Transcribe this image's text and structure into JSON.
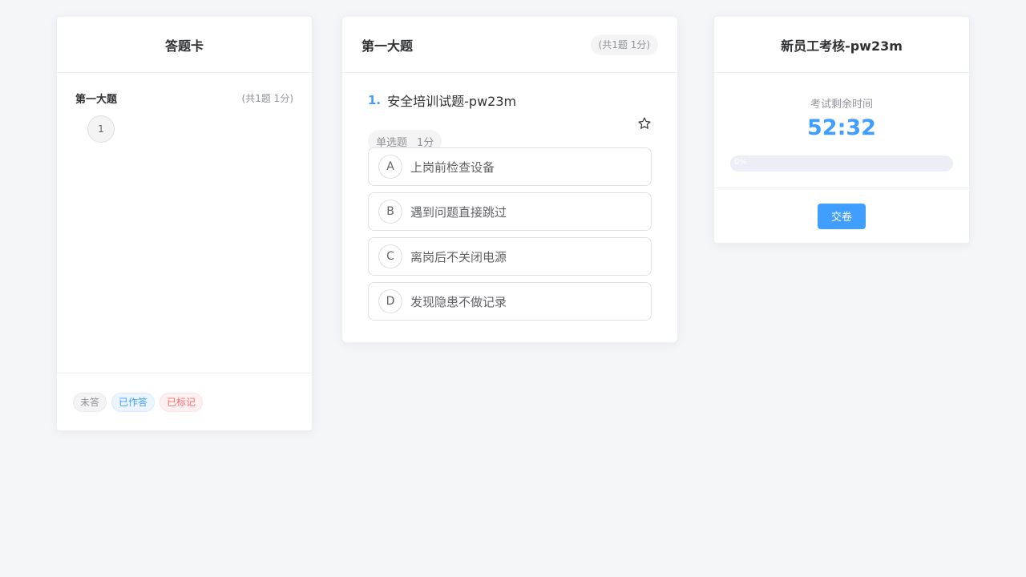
{
  "answer_sheet": {
    "title": "答题卡",
    "section_title": "第一大题",
    "section_count": "(共1题 1分)",
    "question_numbers": [
      "1"
    ],
    "legend": [
      "未答",
      "已作答",
      "已标记"
    ]
  },
  "question_panel": {
    "section_title": "第一大题",
    "section_count": "(共1题 1分)",
    "question": {
      "index": "1.",
      "text": "安全培训试题-pw23m",
      "type": "单选题",
      "score": "1分",
      "options": [
        {
          "key": "A",
          "text": "上岗前检查设备"
        },
        {
          "key": "B",
          "text": "遇到问题直接跳过"
        },
        {
          "key": "C",
          "text": "离岗后不关闭电源"
        },
        {
          "key": "D",
          "text": "发现隐患不做记录"
        }
      ]
    }
  },
  "exam_info": {
    "title": "新员工考核-pw23m",
    "time_label": "考试剩余时间",
    "time_remaining": "52:32",
    "progress": 0,
    "progress_text": "0%",
    "submit_label": "交卷"
  },
  "colors": {
    "accent": "#409eff",
    "marked": "#f56c6c",
    "background": "#f5f6fa"
  },
  "icons": {
    "mark": "star-outline-icon"
  }
}
